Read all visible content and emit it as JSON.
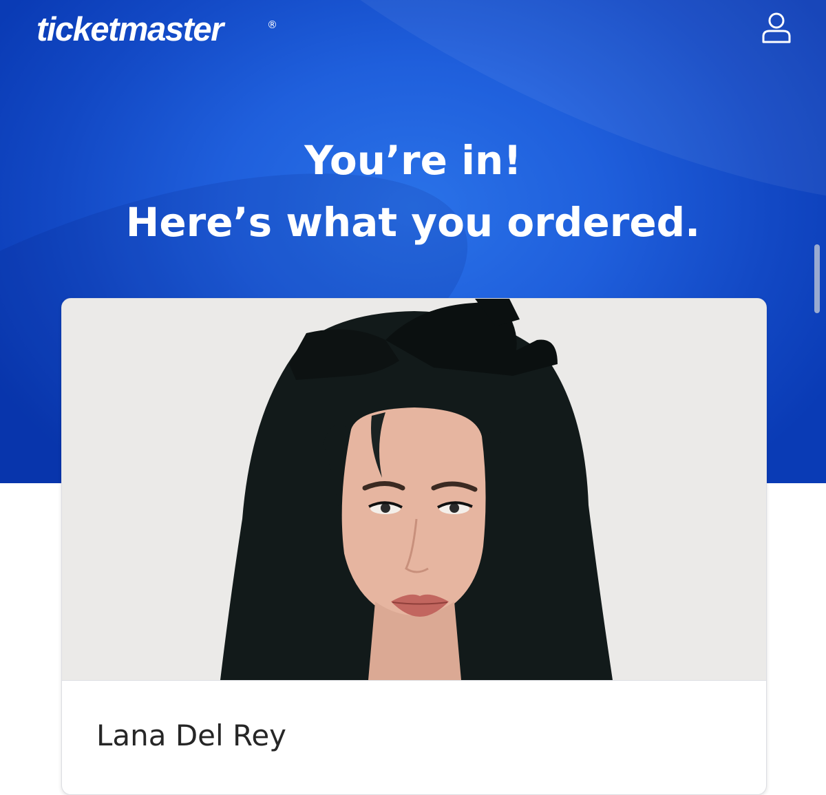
{
  "header": {
    "logo_text": "ticketmaster",
    "logo_mark": "®",
    "account_icon": "user-account-icon"
  },
  "hero": {
    "headline_line1": "You’re in!",
    "headline_line2": "Here’s what you ordered."
  },
  "order": {
    "artist_name": "Lana Del Rey"
  },
  "colors": {
    "brand_blue": "#1f5fdc",
    "dark_blue": "#0a3bb5",
    "text_dark": "#262626",
    "white": "#ffffff"
  }
}
